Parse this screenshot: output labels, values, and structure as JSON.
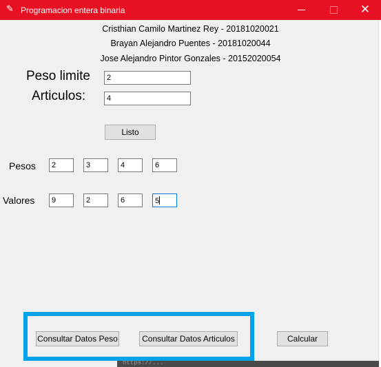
{
  "window": {
    "title": "Programacion entera binaria",
    "minimize_label": "",
    "maximize_label": "",
    "close_label": "✕"
  },
  "authors": [
    "Cristhian Camilo Martinez Rey - 20181020021",
    "Brayan Alejandro Puentes - 20181020044",
    "Jose Alejandro Pintor Gonzales - 20152020054"
  ],
  "form": {
    "peso_limite_label": "Peso limite",
    "peso_limite_value": "2",
    "articulos_label": "Articulos:",
    "articulos_value": "4",
    "listo_label": "Listo"
  },
  "pesos": {
    "label": "Pesos",
    "values": [
      "2",
      "3",
      "4",
      "6"
    ]
  },
  "valores": {
    "label": "Valores",
    "values": [
      "9",
      "2",
      "6",
      "5"
    ]
  },
  "buttons": {
    "consultar_peso": "Consultar Datos Peso",
    "consultar_articulos": "Consultar Datos Articulos",
    "calcular": "Calcular"
  },
  "colors": {
    "titlebar": "#e81123",
    "highlight": "#00a2ed",
    "focus": "#0078d7"
  },
  "background_fragment": "https://..."
}
